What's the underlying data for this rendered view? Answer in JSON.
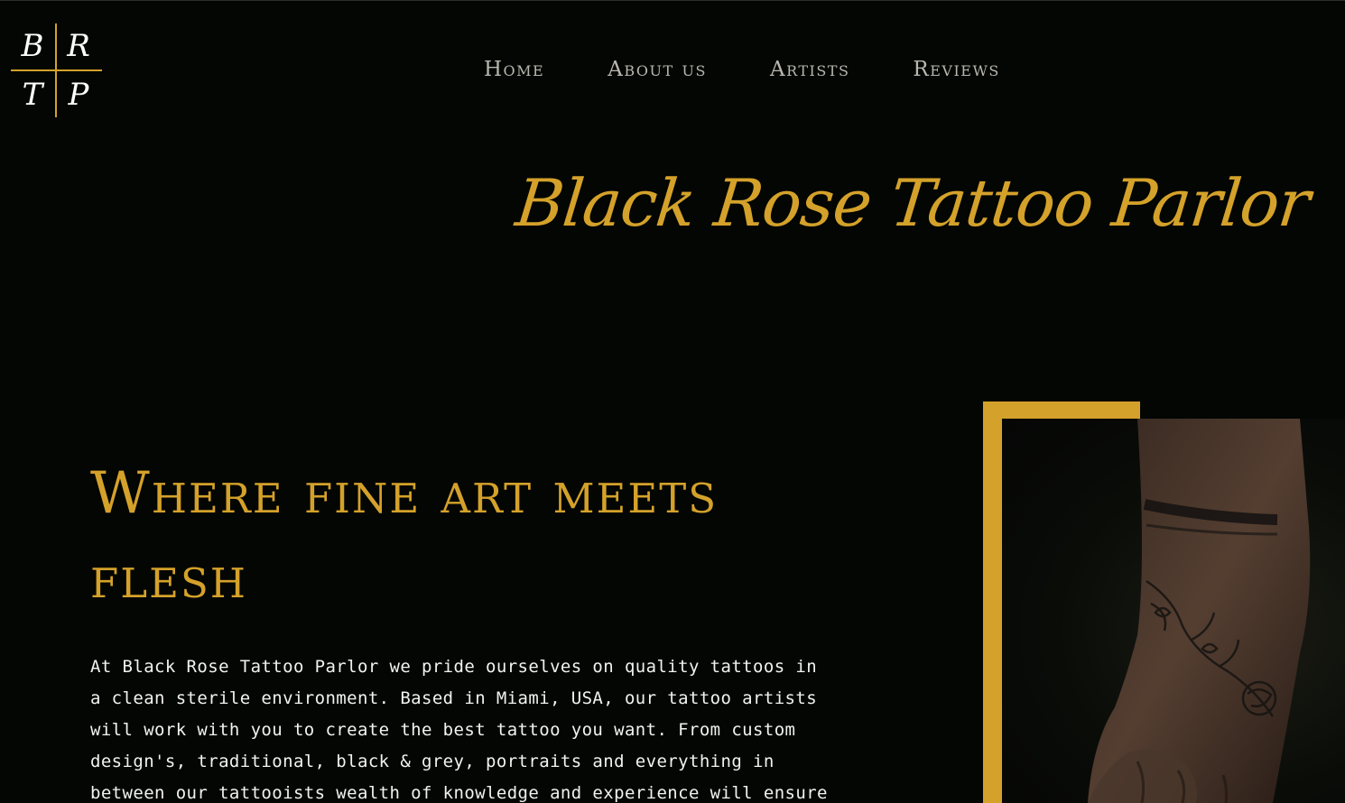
{
  "logo": {
    "letters": [
      "B",
      "R",
      "T",
      "P"
    ]
  },
  "nav": {
    "items": [
      "Home",
      "About us",
      "Artists",
      "Reviews"
    ]
  },
  "brand": {
    "title": "Black Rose Tattoo Parlor"
  },
  "hero": {
    "title": "Where fine art meets flesh",
    "intro": "At Black Rose Tattoo Parlor we pride ourselves on quality tattoos in a clean sterile environment. Based in Miami, USA, our tattoo artists will work with you to create the best tattoo you want. From custom design's, traditional, black & grey, portraits and everything in between our tattooists wealth of knowledge and experience will ensure you get the best tattoo you will be"
  },
  "colors": {
    "background": "#030603",
    "accent": "#d4a12a",
    "nav_text": "#b9b7ae",
    "body_text": "#f2f2ee"
  }
}
